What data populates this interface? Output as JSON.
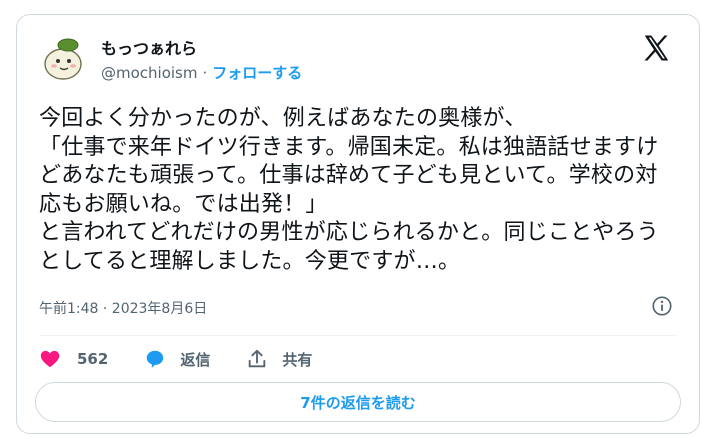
{
  "author": {
    "display_name": "もっつぁれら",
    "handle": "@mochioism",
    "separator": "·",
    "follow_label": "フォローする"
  },
  "tweet": {
    "text": "今回よく分かったのが、例えばあなたの奥様が、\n「仕事で来年ドイツ行きます。帰国未定。私は独語話せますけどあなたも頑張って。仕事は辞めて子ども見といて。学校の対応もお願いね。では出発！」\nと言われてどれだけの男性が応じられるかと。同じことやろうとしてると理解しました。今更ですが…。",
    "timestamp": "午前1:48 · 2023年8月6日"
  },
  "actions": {
    "like_count": "562",
    "reply_label": "返信",
    "share_label": "共有"
  },
  "replies_button": {
    "label": "7件の返信を読む"
  },
  "icons": {
    "platform_logo": "x-logo",
    "info": "info-icon",
    "like": "heart-icon",
    "reply": "reply-bubble-icon",
    "share": "share-icon"
  },
  "colors": {
    "accent": "#1d9bf0",
    "like": "#f91880",
    "text": "#0f1419",
    "secondary": "#536471",
    "border": "#cfd9de"
  }
}
